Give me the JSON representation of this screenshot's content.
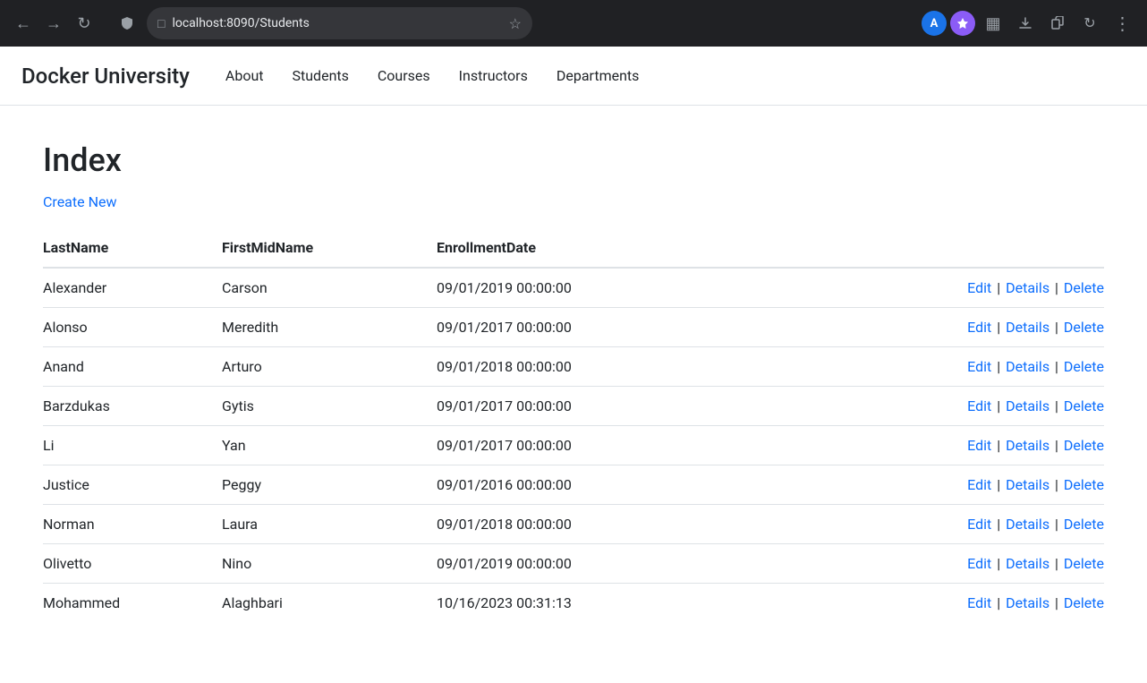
{
  "browser": {
    "url": "localhost:8090/Students",
    "back_label": "←",
    "forward_label": "→",
    "reload_label": "↻",
    "avatar_label": "A",
    "menu_label": "⋮"
  },
  "navbar": {
    "brand": "Docker University",
    "links": [
      {
        "label": "About",
        "href": "#"
      },
      {
        "label": "Students",
        "href": "#"
      },
      {
        "label": "Courses",
        "href": "#"
      },
      {
        "label": "Instructors",
        "href": "#"
      },
      {
        "label": "Departments",
        "href": "#"
      }
    ]
  },
  "page": {
    "title": "Index",
    "create_new_label": "Create New"
  },
  "table": {
    "columns": [
      {
        "key": "lastName",
        "label": "LastName"
      },
      {
        "key": "firstMidName",
        "label": "FirstMidName"
      },
      {
        "key": "enrollmentDate",
        "label": "EnrollmentDate"
      }
    ],
    "rows": [
      {
        "lastName": "Alexander",
        "firstMidName": "Carson",
        "enrollmentDate": "09/01/2019 00:00:00"
      },
      {
        "lastName": "Alonso",
        "firstMidName": "Meredith",
        "enrollmentDate": "09/01/2017 00:00:00"
      },
      {
        "lastName": "Anand",
        "firstMidName": "Arturo",
        "enrollmentDate": "09/01/2018 00:00:00"
      },
      {
        "lastName": "Barzdukas",
        "firstMidName": "Gytis",
        "enrollmentDate": "09/01/2017 00:00:00"
      },
      {
        "lastName": "Li",
        "firstMidName": "Yan",
        "enrollmentDate": "09/01/2017 00:00:00"
      },
      {
        "lastName": "Justice",
        "firstMidName": "Peggy",
        "enrollmentDate": "09/01/2016 00:00:00"
      },
      {
        "lastName": "Norman",
        "firstMidName": "Laura",
        "enrollmentDate": "09/01/2018 00:00:00"
      },
      {
        "lastName": "Olivetto",
        "firstMidName": "Nino",
        "enrollmentDate": "09/01/2019 00:00:00"
      },
      {
        "lastName": "Mohammed",
        "firstMidName": "Alaghbari",
        "enrollmentDate": "10/16/2023 00:31:13"
      }
    ],
    "actions": {
      "edit": "Edit",
      "details": "Details",
      "delete": "Delete"
    }
  },
  "colors": {
    "link": "#0d6efd",
    "text": "#212529",
    "border": "#dee2e6"
  }
}
